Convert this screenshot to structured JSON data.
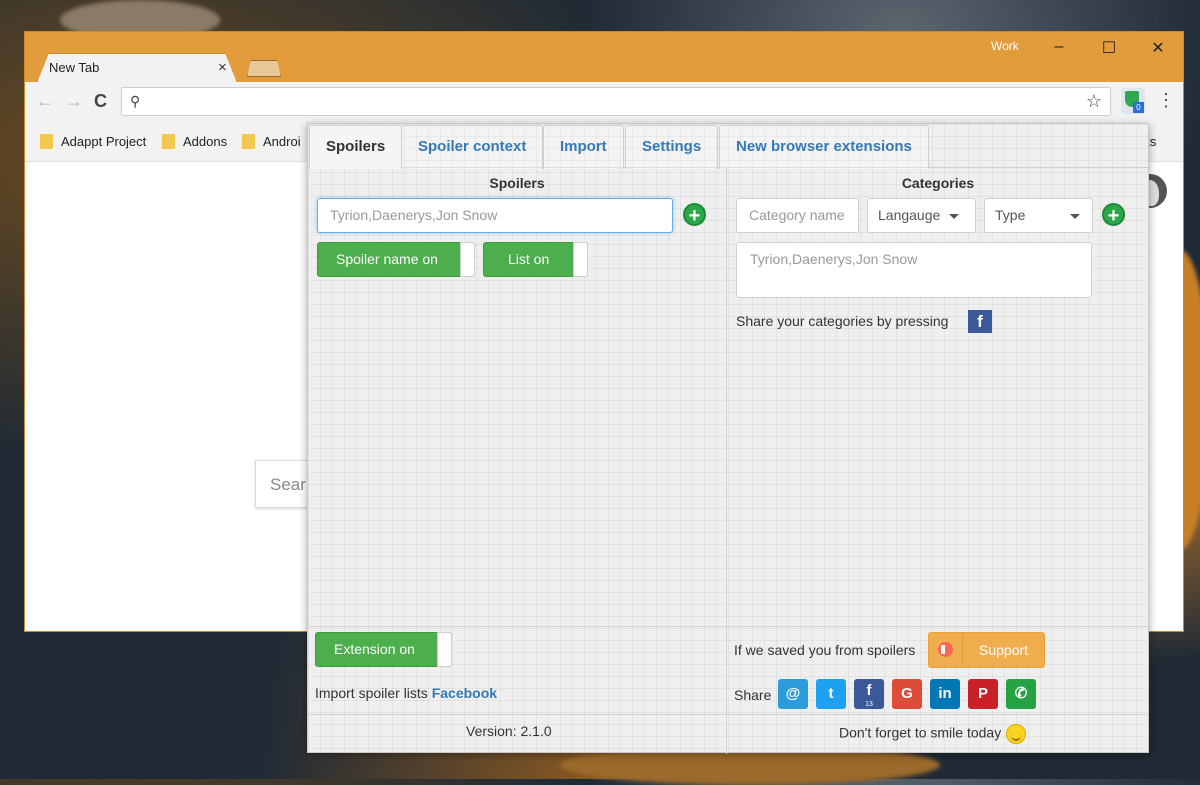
{
  "browser": {
    "profile": "Work",
    "tab": {
      "title": "New Tab"
    },
    "window_controls": {
      "minimize": "–",
      "maximize": "☐",
      "close": "✕"
    },
    "bookmarks": [
      {
        "label": "Adappt Project"
      },
      {
        "label": "Addons"
      },
      {
        "label": "Androi"
      }
    ],
    "bookmarks_overflow": "rks",
    "extension_badge": "0",
    "page_search_text": "Sear"
  },
  "popup": {
    "tabs": [
      {
        "label": "Spoilers",
        "active": true
      },
      {
        "label": "Spoiler context"
      },
      {
        "label": "Import"
      },
      {
        "label": "Settings"
      },
      {
        "label": "New browser extensions"
      }
    ],
    "spoilers": {
      "title": "Spoilers",
      "input_placeholder": "Tyrion,Daenerys,Jon Snow",
      "toggle_spoiler_name": "Spoiler name on",
      "toggle_list": "List on"
    },
    "categories": {
      "title": "Categories",
      "name_placeholder": "Category name",
      "language_select": "Langauge",
      "type_select": "Type",
      "textarea_placeholder": "Tyrion,Daenerys,Jon Snow",
      "share_text": "Share your categories by pressing"
    },
    "footer": {
      "extension_toggle": "Extension on",
      "import_text": "Import spoiler lists",
      "import_link": "Facebook",
      "version": "Version: 2.1.0",
      "saved_text": "If we saved you from spoilers",
      "support_button": "Support",
      "share_label": "Share",
      "share_icons": [
        "email-icon",
        "twitter-icon",
        "facebook-icon",
        "google-icon",
        "linkedin-icon",
        "pinterest-icon",
        "whatsapp-icon"
      ],
      "facebook_count": "13",
      "smile_text": "Don't forget to smile today"
    },
    "colors": {
      "toggle_green": "#4cae4c",
      "add_green": "#2aa84a",
      "link_blue": "#337ab7",
      "support_orange": "#f0ad4e",
      "titlebar_orange": "#e39c3b"
    }
  }
}
